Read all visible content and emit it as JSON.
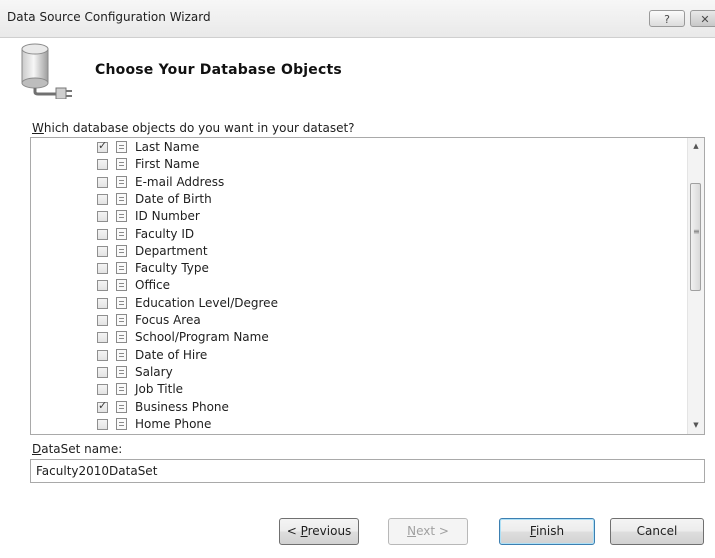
{
  "window": {
    "title": "Data Source Configuration Wizard",
    "help_label": "?",
    "close_label": "✕"
  },
  "header": {
    "heading": "Choose Your Database Objects",
    "icon": "database-connection-icon"
  },
  "objects": {
    "prompt_underlined": "W",
    "prompt_rest": "hich database objects do you want in your dataset?",
    "items": [
      {
        "label": "Last Name",
        "checked": true
      },
      {
        "label": "First Name",
        "checked": false
      },
      {
        "label": "E-mail Address",
        "checked": false
      },
      {
        "label": "Date of Birth",
        "checked": false
      },
      {
        "label": "ID Number",
        "checked": false
      },
      {
        "label": "Faculty ID",
        "checked": false
      },
      {
        "label": "Department",
        "checked": false
      },
      {
        "label": "Faculty Type",
        "checked": false
      },
      {
        "label": "Office",
        "checked": false
      },
      {
        "label": "Education Level/Degree",
        "checked": false
      },
      {
        "label": "Focus Area",
        "checked": false
      },
      {
        "label": "School/Program Name",
        "checked": false
      },
      {
        "label": "Date of Hire",
        "checked": false
      },
      {
        "label": "Salary",
        "checked": false
      },
      {
        "label": "Job Title",
        "checked": false
      },
      {
        "label": "Business Phone",
        "checked": true
      },
      {
        "label": "Home Phone",
        "checked": false
      }
    ],
    "scroll_position": 0.18
  },
  "dataset": {
    "label_underlined": "D",
    "label_rest": "ataSet name:",
    "value": "Faculty2010DataSet"
  },
  "buttons": {
    "previous": {
      "pre": "< ",
      "mnemonic": "P",
      "post": "revious",
      "enabled": true
    },
    "next": {
      "pre": "",
      "mnemonic": "N",
      "post": "ext >",
      "enabled": false
    },
    "finish": {
      "pre": "",
      "mnemonic": "F",
      "post": "inish",
      "enabled": true
    },
    "cancel": {
      "label": "Cancel",
      "enabled": true
    }
  }
}
